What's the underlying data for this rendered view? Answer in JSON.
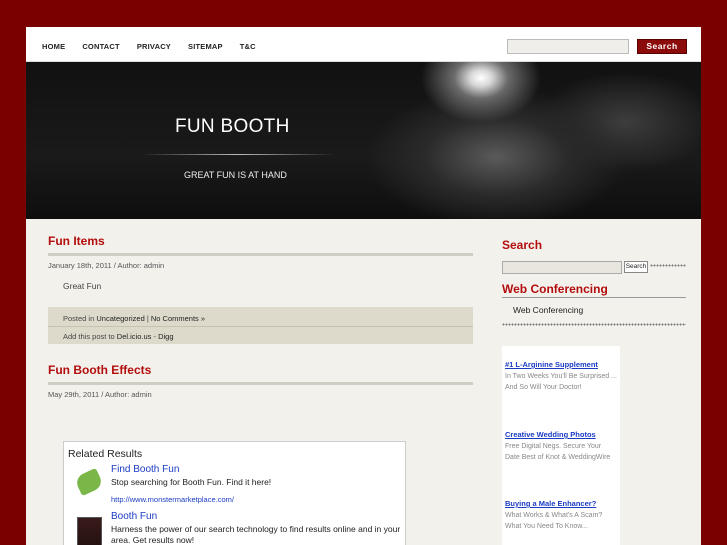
{
  "nav": {
    "items": [
      "HOME",
      "CONTACT",
      "PRIVACY",
      "SITEMAP",
      "T&C"
    ],
    "search_button": "Search"
  },
  "header": {
    "title": "FUN BOOTH",
    "tagline": "GREAT FUN IS AT HAND"
  },
  "posts": [
    {
      "title": "Fun Items",
      "meta": "January 18th, 2011  / Author: admin",
      "body": "Great Fun",
      "posted_in_prefix": "Posted in",
      "category": "Uncategorized",
      "comments": "No Comments »",
      "share_prefix": "Add this post to",
      "share_delicious": "Del.icio.us",
      "share_digg": "Digg"
    },
    {
      "title": "Fun Booth Effects",
      "meta": "May 29th, 2011  / Author: admin"
    }
  ],
  "related": {
    "heading": "Related Results",
    "items": [
      {
        "title": "Find Booth Fun",
        "desc": "Stop searching for Booth Fun. Find it here!",
        "url": "http://www.monstermarketplace.com/",
        "icon": "green-tag-icon"
      },
      {
        "title": "Booth Fun",
        "desc": "Harness the power of our search technology to find results online and in your area. Get results now!",
        "icon": "photo-thumbnail"
      }
    ]
  },
  "sidebar": {
    "search_heading": "Search",
    "search_button": "Search",
    "conf_heading": "Web Conferencing",
    "conf_link": "Web Conferencing",
    "ads": [
      {
        "title": "#1 L-Arginine Supplement",
        "desc": "In Two Weeks You'll Be Surprised ... And So Will Your Doctor!"
      },
      {
        "title": "Creative Wedding Photos",
        "desc": "Free Digital Negs. Secure Your Date Best of Knot & WeddingWire"
      },
      {
        "title": "Buying a Male Enhancer?",
        "desc": "What Works & What's A Scam? What You Need To Know..."
      }
    ]
  },
  "colors": {
    "accent": "#b30d0d",
    "outer_background": "#7a0000",
    "link": "#1a3bc4"
  }
}
